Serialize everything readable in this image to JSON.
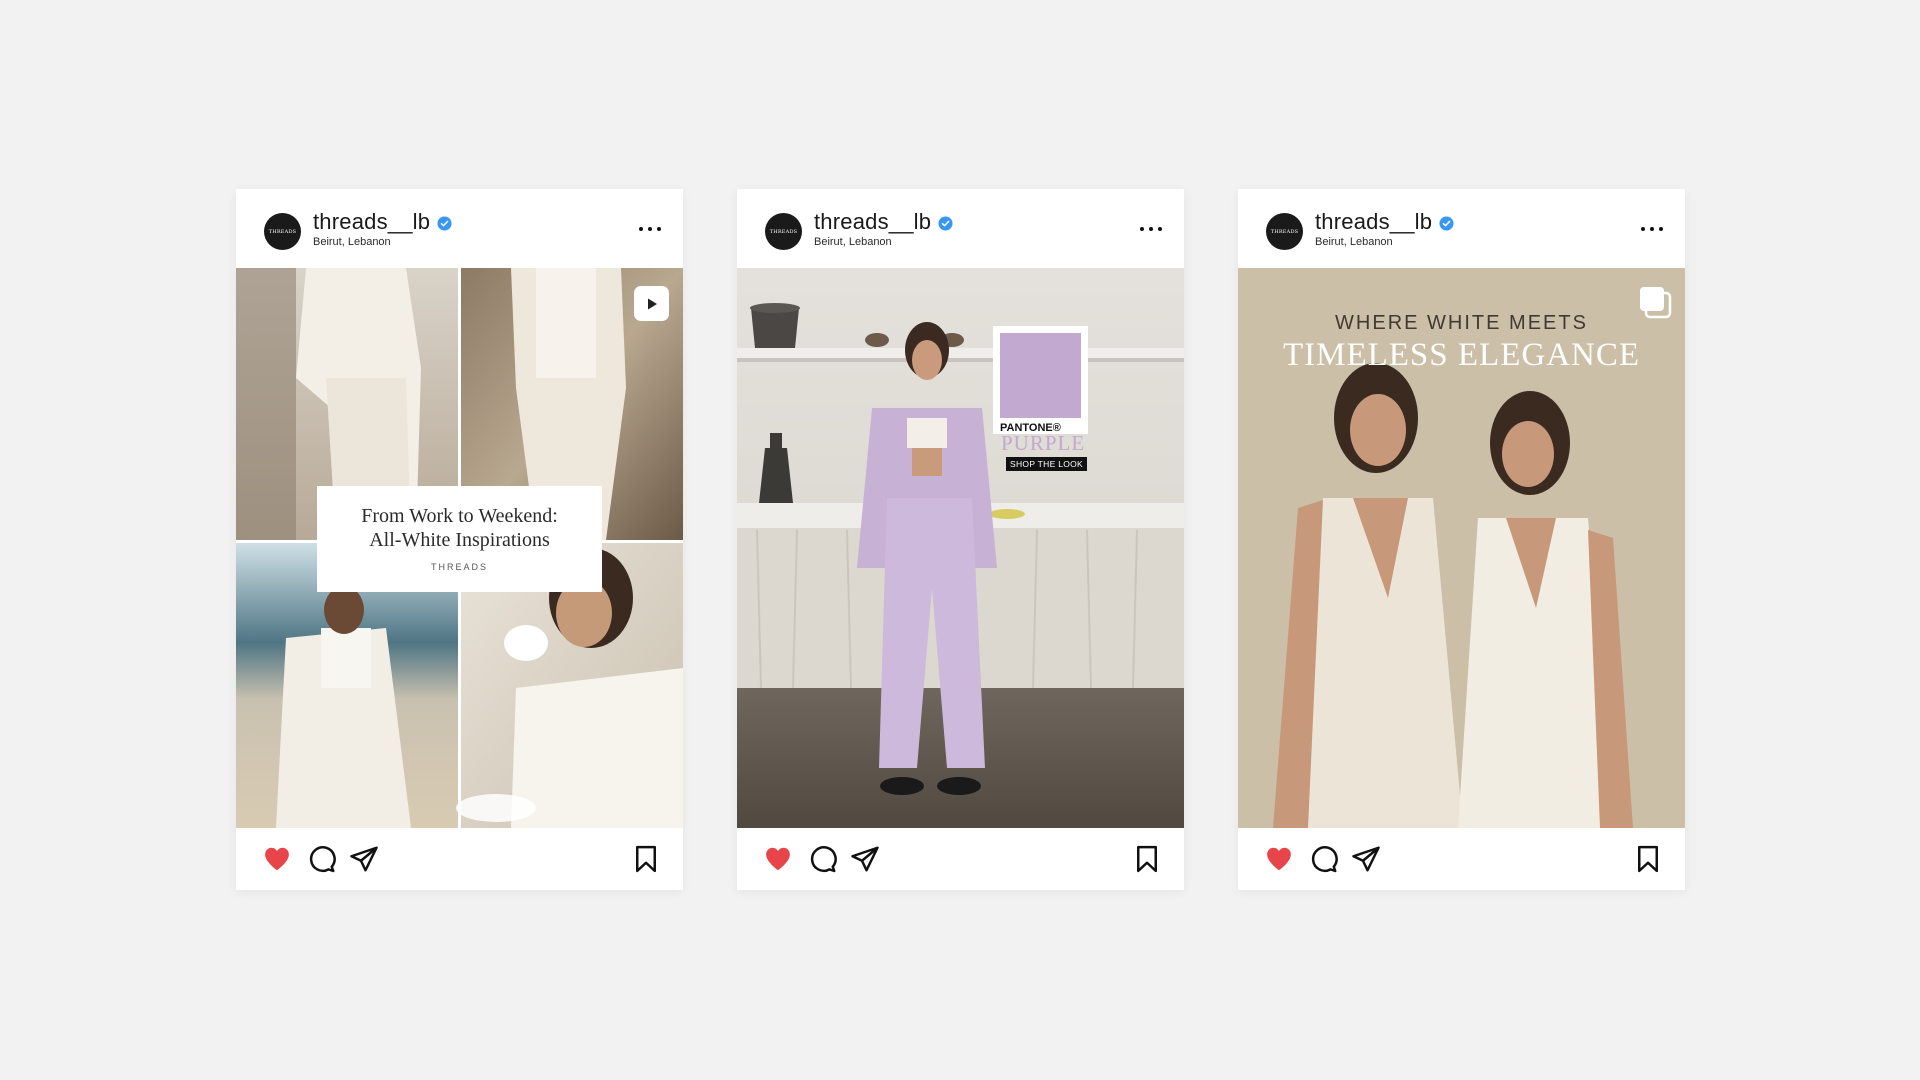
{
  "posts": [
    {
      "username": "threads__lb",
      "location": "Beirut, Lebanon",
      "avatar_text": "THREADS",
      "media_type": "video",
      "caption_title_line1": "From Work to Weekend:",
      "caption_title_line2": "All-White Inspirations",
      "caption_brand": "THREADS"
    },
    {
      "username": "threads__lb",
      "location": "Beirut, Lebanon",
      "avatar_text": "THREADS",
      "media_type": "photo",
      "pantone_brand": "PANTONE®",
      "pantone_color": "PURPLE",
      "shop_label": "SHOP THE LOOK"
    },
    {
      "username": "threads__lb",
      "location": "Beirut, Lebanon",
      "avatar_text": "THREADS",
      "media_type": "carousel",
      "headline_small": "WHERE WHITE MEETS",
      "headline_large": "TIMELESS ELEGANCE"
    }
  ],
  "icons": {
    "verified": "verified-badge-icon",
    "more": "more-dots-icon",
    "like": "heart-icon",
    "comment": "comment-icon",
    "share": "paper-plane-icon",
    "save": "bookmark-icon",
    "play": "play-icon",
    "carousel": "carousel-icon"
  },
  "colors": {
    "page_background": "#f2f2f2",
    "card_background": "#ffffff",
    "like_red": "#e8454b",
    "verified_blue": "#3897f0",
    "pantone_purple": "#c2a9cf",
    "beige_background": "#cbbfa8"
  }
}
